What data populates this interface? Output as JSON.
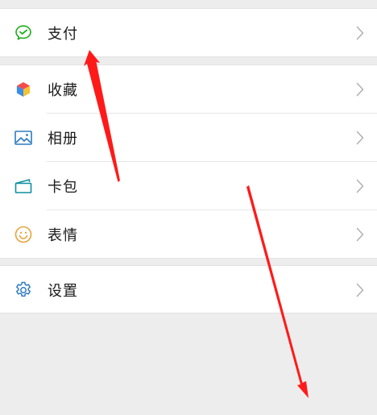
{
  "menu": {
    "groups": [
      {
        "items": [
          {
            "label": "支付",
            "icon": "wechat-pay-icon"
          }
        ]
      },
      {
        "items": [
          {
            "label": "收藏",
            "icon": "favorites-cube-icon"
          },
          {
            "label": "相册",
            "icon": "photo-album-icon"
          },
          {
            "label": "卡包",
            "icon": "card-wallet-icon"
          },
          {
            "label": "表情",
            "icon": "smiley-face-icon"
          }
        ]
      },
      {
        "items": [
          {
            "label": "设置",
            "icon": "settings-gear-icon"
          }
        ]
      }
    ]
  },
  "colors": {
    "pay_green": "#1aad19",
    "album_blue": "#2e7bc2",
    "card_teal": "#0e8fa0",
    "smiley_orange": "#e6a33c",
    "settings_blue": "#2e7bc2",
    "arrow_red": "#ff1a1a",
    "chevron_gray": "#b2b2b2"
  }
}
